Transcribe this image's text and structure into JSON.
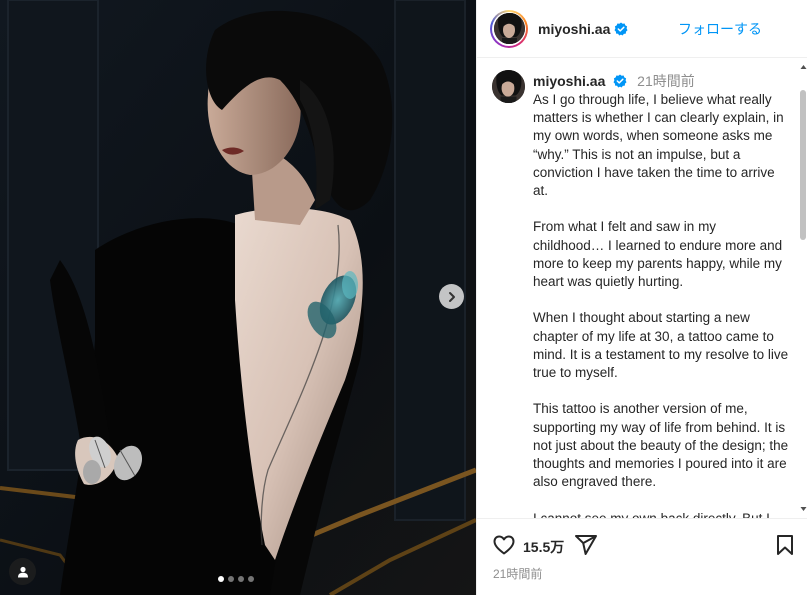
{
  "post": {
    "username": "miyoshi.aa",
    "follow_label": "フォローする",
    "relative_time": "21時間前",
    "caption_paragraphs": [
      "As I go through life, I believe what really matters is whether I can clearly explain, in my own words, when someone asks me “why.”  This is not an impulse, but a conviction I have taken the time to arrive at.",
      "From what I felt and saw in my childhood… I learned to endure more and more to keep my parents happy, while my heart was quietly hurting.",
      "When I thought about starting a new chapter of my life at 30, a tattoo came to mind. It is a testament to my resolve to live true to myself.",
      "This tattoo is another version of me, supporting my way of life from behind. It is not just about the beauty of the design; the thoughts and memories I poured into it are also engraved there.",
      "I cannot see my own back directly. But I"
    ],
    "like_count": "15.5万",
    "footer_time": "21時間前"
  },
  "carousel": {
    "slide_count": 4,
    "active_index": 0
  },
  "icons": {
    "verified": "verified-badge-icon",
    "next": "chevron-right-icon",
    "tag": "user-tag-icon",
    "like": "heart-icon",
    "share": "paper-plane-icon",
    "save": "bookmark-icon"
  },
  "colors": {
    "accent": "#0095f6",
    "muted": "#8e8e8e",
    "text": "#262626"
  }
}
